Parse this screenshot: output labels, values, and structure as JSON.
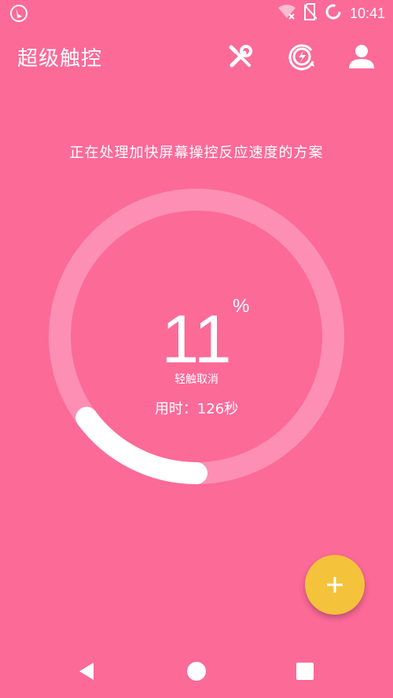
{
  "status_bar": {
    "time": "10:41",
    "icons": [
      "notification-icon",
      "wifi-off-icon",
      "no-sim-icon",
      "battery-ring-icon"
    ]
  },
  "app_bar": {
    "title": "超级触控",
    "actions": [
      "tools-icon",
      "boost-icon",
      "account-icon"
    ]
  },
  "main": {
    "message": "正在处理加快屏幕操控反应速度的方案",
    "progress": {
      "value": "11",
      "unit": "%",
      "fraction": 0.11,
      "cancel_label": "轻触取消",
      "elapsed_text": "用时：126秒"
    }
  },
  "fab": {
    "icon": "plus-icon"
  },
  "navigation_bar": {
    "icons": [
      "back-icon",
      "home-icon",
      "recents-icon"
    ]
  },
  "colors": {
    "background": "#FC6A98",
    "ring_track": "#FD8FB5",
    "ring_progress": "#FFFFFF",
    "fab": "#F4C23B"
  }
}
